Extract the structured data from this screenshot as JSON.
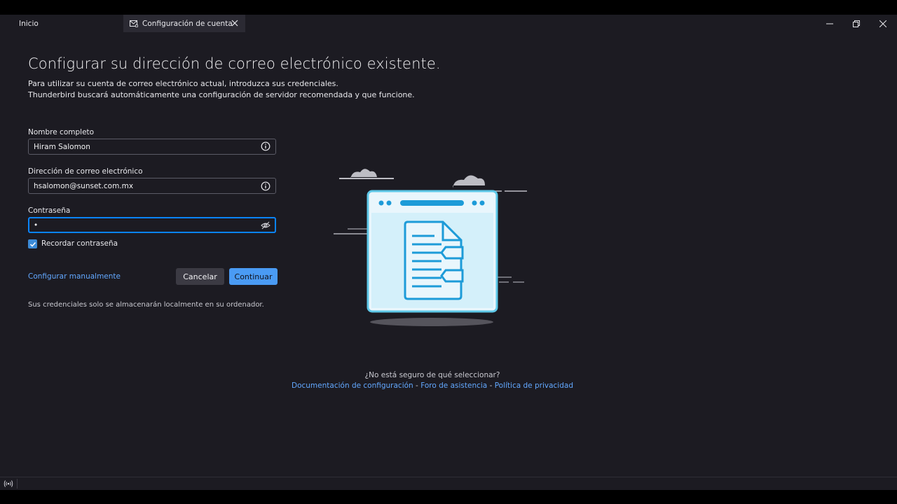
{
  "tabs": {
    "home_label": "Inicio",
    "active_label": "Configuración de cuenta"
  },
  "page": {
    "title": "Configurar su dirección de correo electrónico existente.",
    "desc1": "Para utilizar su cuenta de correo electrónico actual, introduzca sus credenciales.",
    "desc2": "Thunderbird buscará automáticamente una configuración de servidor recomendada y que funcione."
  },
  "form": {
    "name_label": "Nombre completo",
    "name_value": "Hiram Salomon",
    "email_label": "Dirección de correo electrónico",
    "email_value": "hsalomon@sunset.com.mx",
    "password_label": "Contraseña",
    "password_value": "•",
    "remember_label": "Recordar contraseña",
    "remember_checked": true
  },
  "actions": {
    "manual_link": "Configurar manualmente",
    "cancel_label": "Cancelar",
    "continue_label": "Continuar"
  },
  "note": "Sus credenciales solo se almacenarán localmente en su ordenador.",
  "help": {
    "question": "¿No está seguro de qué seleccionar?",
    "doc_link": "Documentación de configuración",
    "forum_link": "Foro de asistencia",
    "privacy_link": "Política de privacidad",
    "separator": " - "
  },
  "colors": {
    "accent": "#0a84ff",
    "button_primary": "#4a9bf4",
    "link": "#62a8ff",
    "background": "#1c1b22"
  }
}
